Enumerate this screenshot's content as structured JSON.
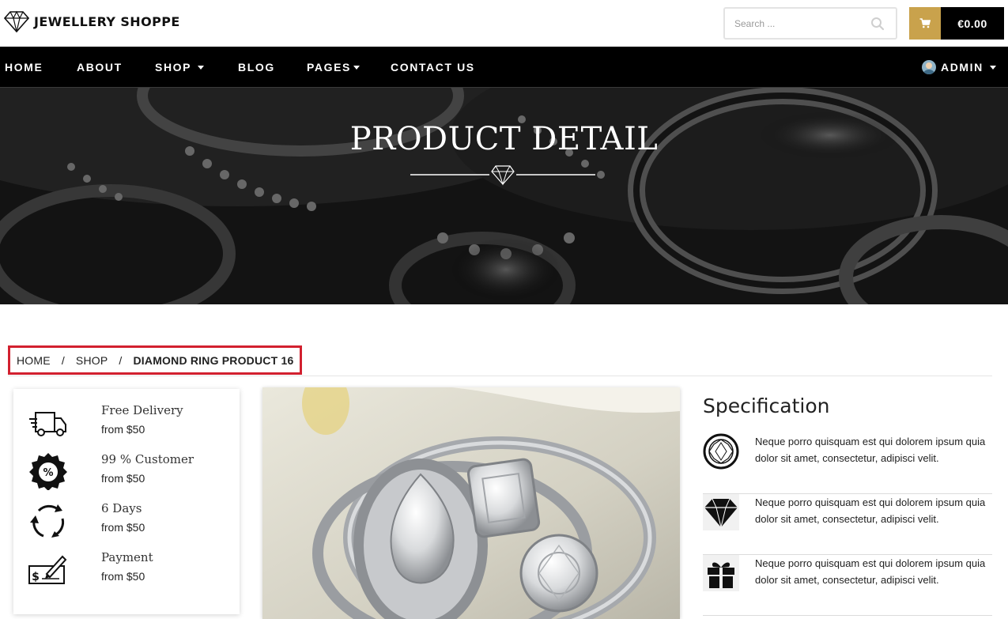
{
  "brand": {
    "name": "JEWELLERY SHOPPE"
  },
  "search": {
    "placeholder": "Search ..."
  },
  "cart": {
    "total": "€0.00"
  },
  "nav": {
    "home": "HOME",
    "about": "ABOUT",
    "shop": "SHOP",
    "blog": "BLOG",
    "pages": "PAGES",
    "contact": "CONTACT US",
    "user": "ADMIN"
  },
  "hero": {
    "title": "PRODUCT DETAIL"
  },
  "breadcrumb": {
    "home": "HOME",
    "shop": "SHOP",
    "current": "DIAMOND RING PRODUCT 16",
    "separator": "/"
  },
  "features": [
    {
      "title": "Free Delivery",
      "subtitle": "from $50",
      "icon": "delivery-truck-icon"
    },
    {
      "title": "99 % Customer",
      "subtitle": "from $50",
      "icon": "percent-badge-icon"
    },
    {
      "title": "6 Days",
      "subtitle": "from $50",
      "icon": "return-cycle-icon"
    },
    {
      "title": "Payment",
      "subtitle": "from $50",
      "icon": "cheque-payment-icon"
    }
  ],
  "specification": {
    "title": "Specification",
    "items": [
      {
        "text": "Neque porro quisquam est qui dolorem ipsum quia dolor sit amet, consectetur, adipisci velit.",
        "icon": "round-diamond-icon"
      },
      {
        "text": "Neque porro quisquam est qui dolorem ipsum quia dolor sit amet, consectetur, adipisci velit.",
        "icon": "diamond-icon"
      },
      {
        "text": "Neque porro quisquam est qui dolorem ipsum quia dolor sit amet, consectetur, adipisci velit.",
        "icon": "gift-box-icon"
      }
    ]
  },
  "colors": {
    "accent_gold": "#c9a24c",
    "nav_bg": "#000000",
    "breadcrumb_highlight": "#d2202f"
  }
}
